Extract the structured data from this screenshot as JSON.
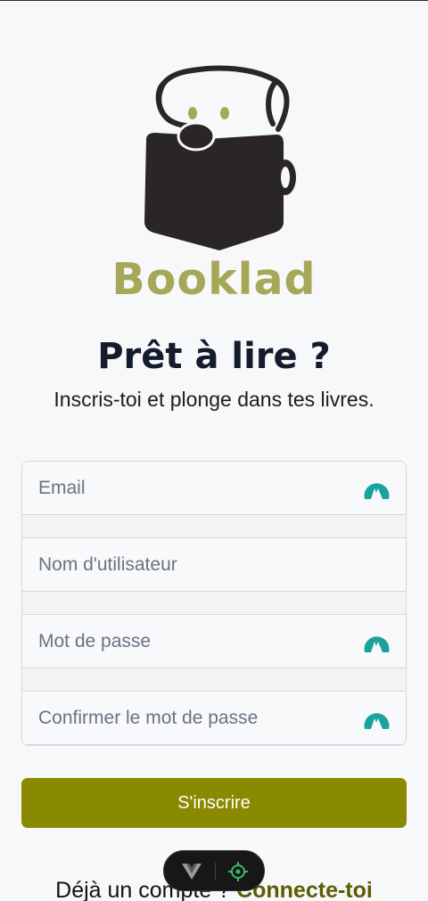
{
  "brand": {
    "name": "Booklad",
    "color": "#a7a857"
  },
  "heading": {
    "title": "Prêt à lire ?",
    "subtitle": "Inscris-toi et plonge dans tes livres."
  },
  "form": {
    "email_placeholder": "Email",
    "username_placeholder": "Nom d'utilisateur",
    "password_placeholder": "Mot de passe",
    "confirm_password_placeholder": "Confirmer le mot de passe",
    "password_manager_icon": "nordpass-icon",
    "password_manager_color": "#1aa39d"
  },
  "submit": {
    "label": "S'inscrire",
    "color": "#8a8a00"
  },
  "footer": {
    "text": "Déjà un compte ? ",
    "link_label": "Connecte-toi",
    "link_color": "#5c5c00"
  },
  "devtools": {
    "vue_icon": "vue-devtools-icon",
    "inspector_icon": "crosshair-icon",
    "accent": "#3fb86f"
  }
}
